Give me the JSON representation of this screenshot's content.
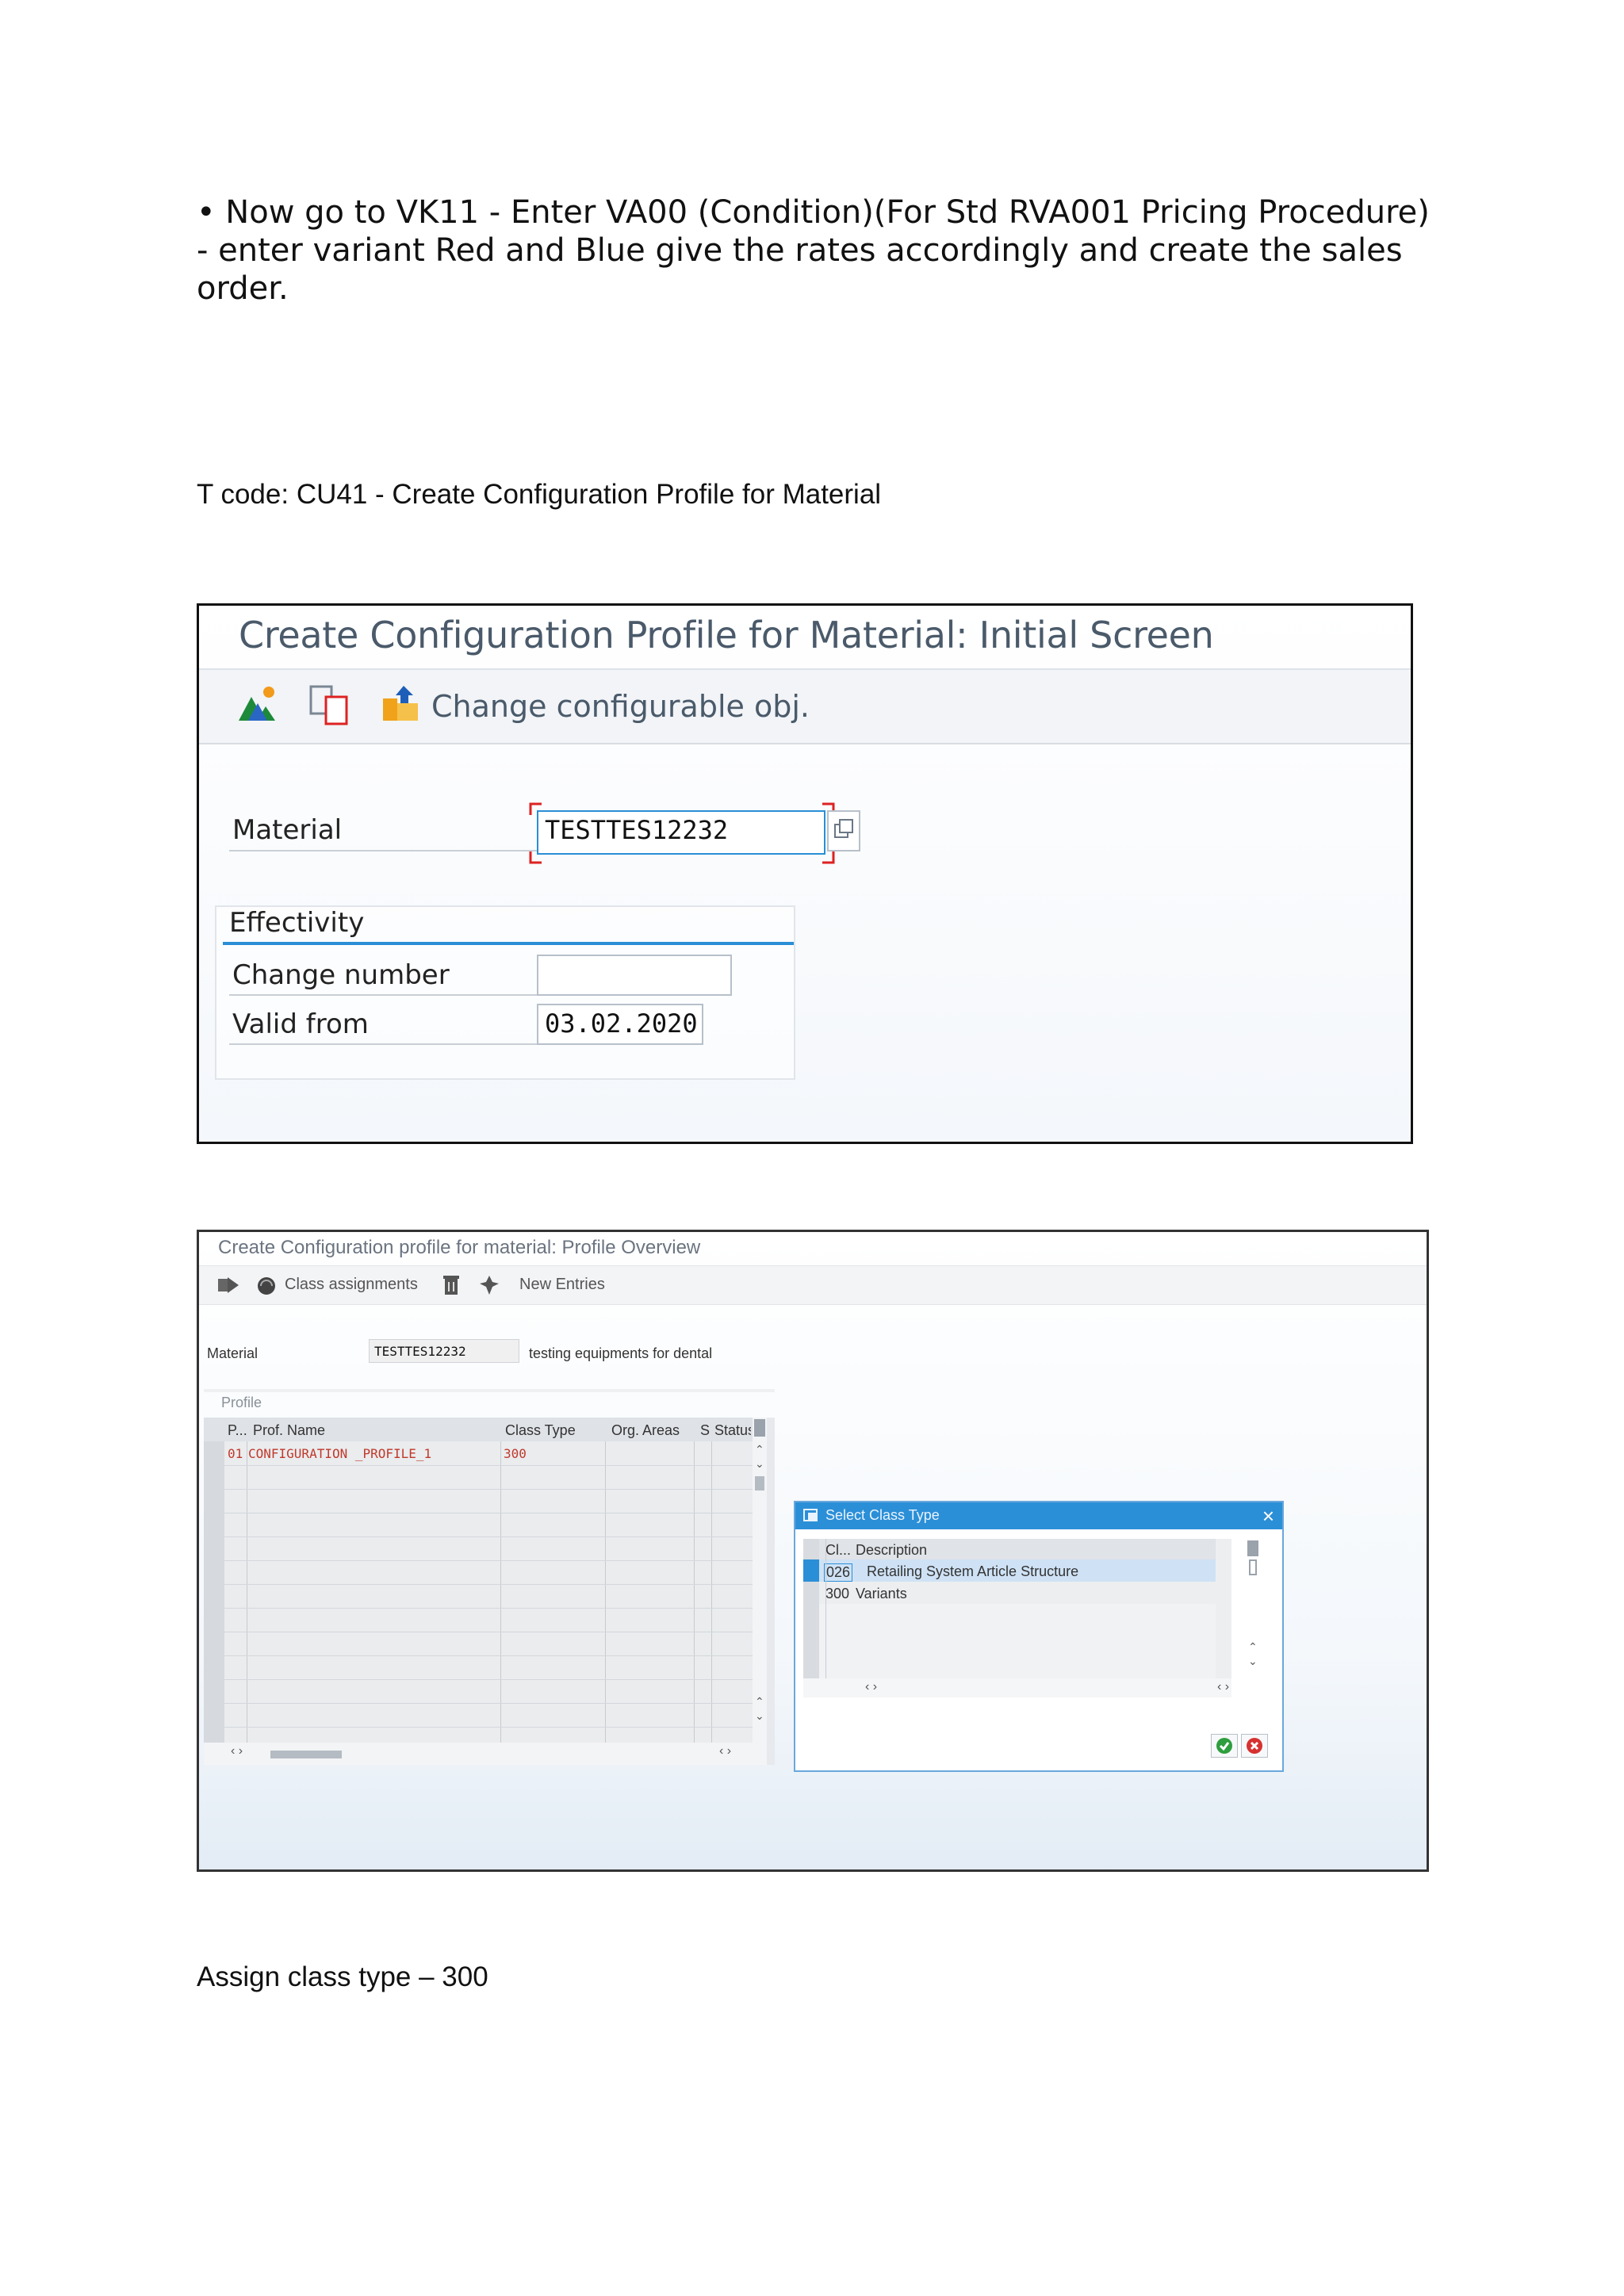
{
  "document": {
    "bullet_text": "• Now go to VK11 - Enter VA00 (Condition)(For Std RVA001 Pricing  Procedure) - enter variant Red and Blue give the rates accordingly and create the sales order.",
    "tcode_line": "T code:  CU41  -  Create Configuration Profile for Material",
    "assign_line": "Assign class type – 300"
  },
  "screen1": {
    "title": "Create Configuration Profile for Material: Initial Screen",
    "toolbar": {
      "icons": [
        "profile-icon",
        "copy-icon",
        "change-object-icon"
      ],
      "change_label": "Change configurable obj."
    },
    "material_label": "Material",
    "material_value": "TESTTES12232",
    "effectivity": {
      "group_title": "Effectivity",
      "change_number_label": "Change number",
      "change_number_value": "",
      "valid_from_label": "Valid from",
      "valid_from_value": "03.02.2020"
    }
  },
  "screen2": {
    "title": "Create Configuration profile for material: Profile Overview",
    "toolbar": {
      "class_assignments": "Class assignments",
      "new_entries": "New Entries"
    },
    "material_label": "Material",
    "material_value": "TESTTES12232",
    "material_desc": "testing equipments for dental",
    "profile_section": "Profile",
    "columns": [
      "P...",
      "Prof. Name",
      "Class Type",
      "Org. Areas",
      "S",
      "Status"
    ],
    "rows": [
      {
        "p": "01",
        "name": "CONFIGURATION _PROFILE_1",
        "class_type": "300",
        "org": "",
        "s": "",
        "status": ""
      }
    ],
    "dialog": {
      "title": "Select Class Type",
      "col_class": "Cl...",
      "col_desc": "Description",
      "rows": [
        {
          "class": "026",
          "desc": "Retailing System Article Structure"
        },
        {
          "class": "300",
          "desc": "Variants"
        }
      ]
    }
  }
}
